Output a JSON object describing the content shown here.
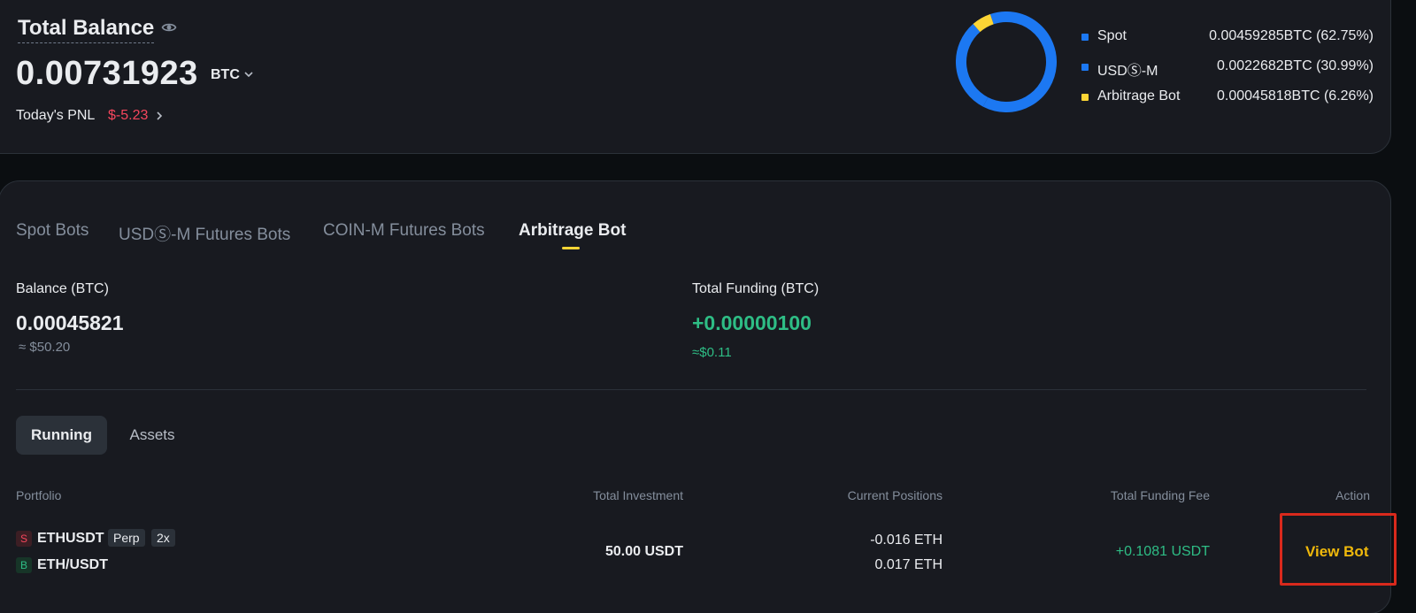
{
  "summary": {
    "title": "Total Balance",
    "value": "0.00731923",
    "unit": "BTC",
    "pnl_label": "Today's PNL",
    "pnl_value": "$-5.23"
  },
  "allocation": [
    {
      "name": "Spot",
      "value": "0.00459285BTC (62.75%)",
      "percent": 62.75,
      "color": "#1c78f2"
    },
    {
      "name": "USDⓈ-M",
      "value": "0.0022682BTC (30.99%)",
      "percent": 30.99,
      "color": "#1c78f2"
    },
    {
      "name": "Arbitrage Bot",
      "value": "0.00045818BTC (6.26%)",
      "percent": 6.26,
      "color": "#fcd535"
    }
  ],
  "tabs": [
    "Spot Bots",
    "USDⓈ-M Futures Bots",
    "COIN-M Futures Bots",
    "Arbitrage Bot"
  ],
  "active_tab": "Arbitrage Bot",
  "balance": {
    "label": "Balance (BTC)",
    "value": "0.00045821",
    "usd": "≈ $50.20"
  },
  "funding": {
    "label": "Total Funding (BTC)",
    "value": "+0.00000100",
    "usd": "≈$0.11"
  },
  "sub_tabs": [
    "Running",
    "Assets"
  ],
  "table": {
    "headers": [
      "Portfolio",
      "Total Investment",
      "Current Positions",
      "Total Funding Fee",
      "Action"
    ],
    "row": {
      "leg1_side": "S",
      "leg1_symbol": "ETHUSDT",
      "leg1_tag": "Perp",
      "leg1_leverage": "2x",
      "leg2_side": "B",
      "leg2_symbol": "ETH/USDT",
      "investment": "50.00 USDT",
      "position1": "-0.016 ETH",
      "position2": "0.017 ETH",
      "funding_fee": "+0.1081 USDT",
      "action": "View Bot"
    }
  },
  "colors": {
    "accent": "#fcd535",
    "positive": "#2ebd85",
    "negative": "#f6465d",
    "action": "#f0b90b"
  }
}
